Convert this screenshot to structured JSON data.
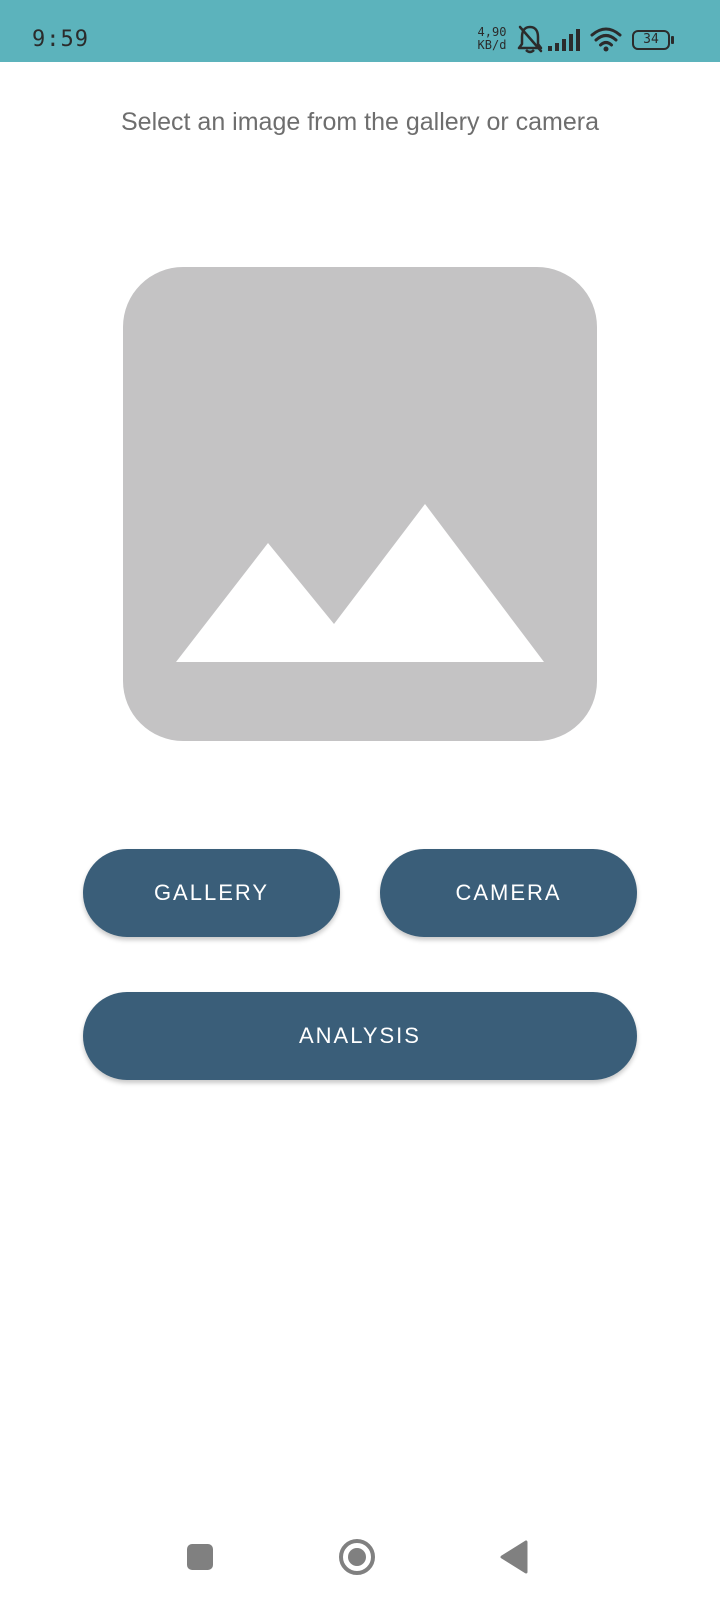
{
  "status_bar": {
    "time": "9:59",
    "net_speed_value": "4,90",
    "net_speed_unit": "KB/d",
    "battery_level": "34",
    "background_color": "#5cb3bc",
    "icons": [
      "bell-off-icon",
      "cell-signal-icon",
      "wifi-icon",
      "battery-icon"
    ]
  },
  "main": {
    "instruction": "Select an image from the gallery or camera",
    "placeholder_icon": "image-placeholder-icon",
    "placeholder_color": "#c4c3c4"
  },
  "buttons": {
    "gallery_label": "GALLERY",
    "camera_label": "CAMERA",
    "analysis_label": "ANALYSIS",
    "color": "#3a5e79"
  },
  "nav_bar": {
    "icons": [
      "recent-apps-icon",
      "home-icon",
      "back-icon"
    ]
  }
}
